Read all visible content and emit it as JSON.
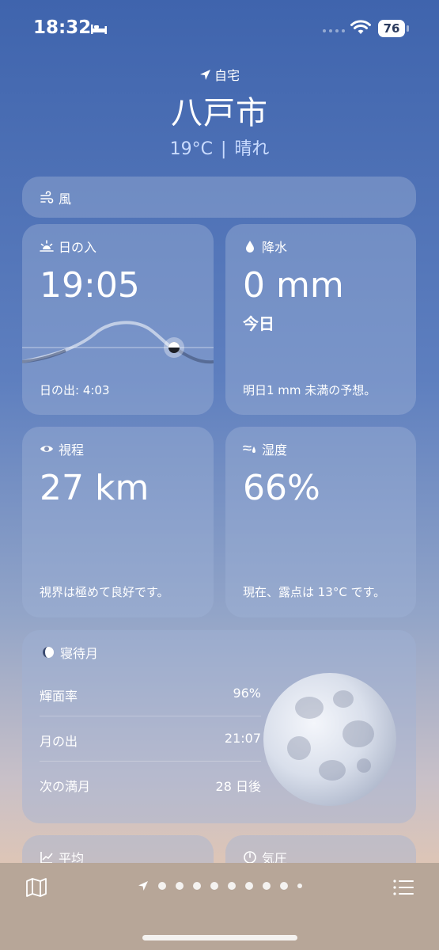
{
  "status": {
    "time": "18:32",
    "battery": "76"
  },
  "header": {
    "location_label": "自宅",
    "city": "八戸市",
    "temperature": "19°C",
    "condition": "晴れ",
    "separator": "|"
  },
  "wind": {
    "title": "風"
  },
  "sunset": {
    "title": "日の入",
    "time": "19:05",
    "footer": "日の出: 4:03"
  },
  "precipitation": {
    "title": "降水",
    "value": "0 mm",
    "period": "今日",
    "footer": "明日1 mm 未満の予想。"
  },
  "visibility": {
    "title": "視程",
    "value": "27 km",
    "footer": "視界は極めて良好です。"
  },
  "humidity": {
    "title": "湿度",
    "value": "66%",
    "footer": "現在、露点は 13°C です。"
  },
  "moon": {
    "title": "寝待月",
    "rows": [
      {
        "label": "輝面率",
        "value": "96%"
      },
      {
        "label": "月の出",
        "value": "21:07"
      },
      {
        "label": "次の満月",
        "value": "28 日後"
      }
    ]
  },
  "bottom_cards": {
    "average_title": "平均",
    "pressure_title": "気圧"
  },
  "icons": [
    "bed-icon",
    "wifi-icon",
    "location-arrow-icon",
    "wind-icon",
    "sunset-icon",
    "raindrop-icon",
    "eye-icon",
    "humidity-icon",
    "moon-phase-icon",
    "chart-icon",
    "gauge-icon",
    "map-icon",
    "list-icon"
  ]
}
